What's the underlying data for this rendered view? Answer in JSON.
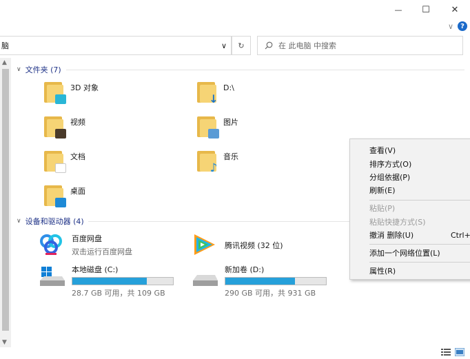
{
  "window": {
    "minimize_glyph": "—",
    "maximize_glyph": "☐",
    "close_glyph": "✕",
    "ribbon_toggle_glyph": "∨",
    "help_glyph": "?"
  },
  "address": {
    "path_text": "脑",
    "dropdown_glyph": "∨",
    "refresh_glyph": "↻"
  },
  "search": {
    "placeholder": "在 此电脑 中搜索",
    "icon": "search-icon"
  },
  "folders_group": {
    "title": "文件夹 (7)",
    "items": [
      {
        "label": "3D 对象",
        "icon": "3d-objects-folder-icon"
      },
      {
        "label": "D:\\",
        "icon": "downloads-folder-icon"
      },
      {
        "label": "视频",
        "icon": "videos-folder-icon"
      },
      {
        "label": "图片",
        "icon": "pictures-folder-icon"
      },
      {
        "label": "文档",
        "icon": "documents-folder-icon"
      },
      {
        "label": "音乐",
        "icon": "music-folder-icon"
      },
      {
        "label": "桌面",
        "icon": "desktop-folder-icon"
      }
    ]
  },
  "devices_group": {
    "title": "设备和驱动器 (4)",
    "apps": [
      {
        "label": "百度网盘",
        "sub": "双击运行百度网盘",
        "icon": "baidu-netdisk-icon"
      },
      {
        "label": "腾讯视频 (32 位)",
        "icon": "tencent-video-icon"
      }
    ],
    "drives": [
      {
        "label": "本地磁盘 (C:)",
        "space": "28.7 GB 可用，共 109 GB",
        "used_fraction": 0.74,
        "icon": "windows-drive-icon"
      },
      {
        "label": "新加卷 (D:)",
        "space": "290 GB 可用，共 931 GB",
        "used_fraction": 0.69,
        "icon": "hard-drive-icon"
      }
    ]
  },
  "context_menu": {
    "items": [
      {
        "label": "查看(V)",
        "disabled": false
      },
      {
        "label": "排序方式(O)",
        "disabled": false
      },
      {
        "label": "分组依据(P)",
        "disabled": false
      },
      {
        "label": "刷新(E)",
        "disabled": false
      },
      {
        "label": "粘贴(P)",
        "disabled": true
      },
      {
        "label": "粘贴快捷方式(S)",
        "disabled": true
      },
      {
        "label": "撤消 删除(U)",
        "disabled": false,
        "shortcut": "Ctrl+Z"
      },
      {
        "label": "添加一个网络位置(L)",
        "disabled": false
      },
      {
        "label": "属性(R)",
        "disabled": false
      }
    ]
  },
  "colors": {
    "accent": "#26a0da",
    "group_heading": "#1e3287",
    "folder": "#f6d475"
  }
}
